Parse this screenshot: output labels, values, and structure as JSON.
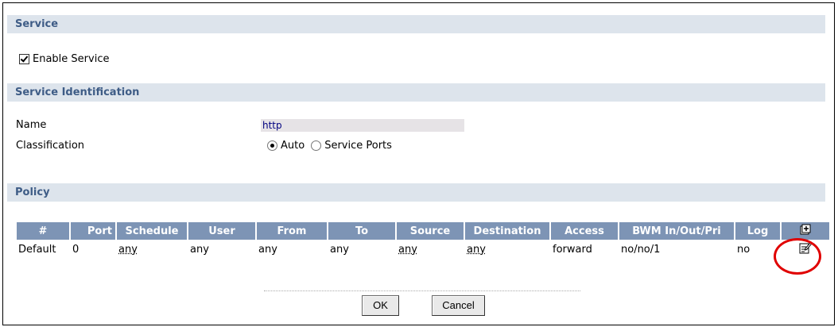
{
  "service": {
    "header": "Service",
    "enable_checkbox": {
      "label": "Enable Service",
      "checked": true
    }
  },
  "identification": {
    "header": "Service Identification",
    "name_label": "Name",
    "name_value": "http",
    "classification_label": "Classification",
    "classification_options": [
      {
        "label": "Auto",
        "selected": true
      },
      {
        "label": "Service Ports",
        "selected": false
      }
    ]
  },
  "policy": {
    "header": "Policy",
    "columns": [
      "#",
      "Port",
      "Schedule",
      "User",
      "From",
      "To",
      "Source",
      "Destination",
      "Access",
      "BWM In/Out/Pri",
      "Log"
    ],
    "rows": [
      {
        "id": "Default",
        "port": "0",
        "schedule": "any",
        "user": "any",
        "from": "any",
        "to": "any",
        "source": "any",
        "destination": "any",
        "access": "forward",
        "bwm": "no/no/1",
        "log": "no"
      }
    ]
  },
  "buttons": {
    "ok": "OK",
    "cancel": "Cancel"
  },
  "colors": {
    "header_bg": "#dde4ec",
    "header_text": "#3e5c86",
    "table_header_bg": "#7d94b5",
    "highlight": "#e00000"
  }
}
